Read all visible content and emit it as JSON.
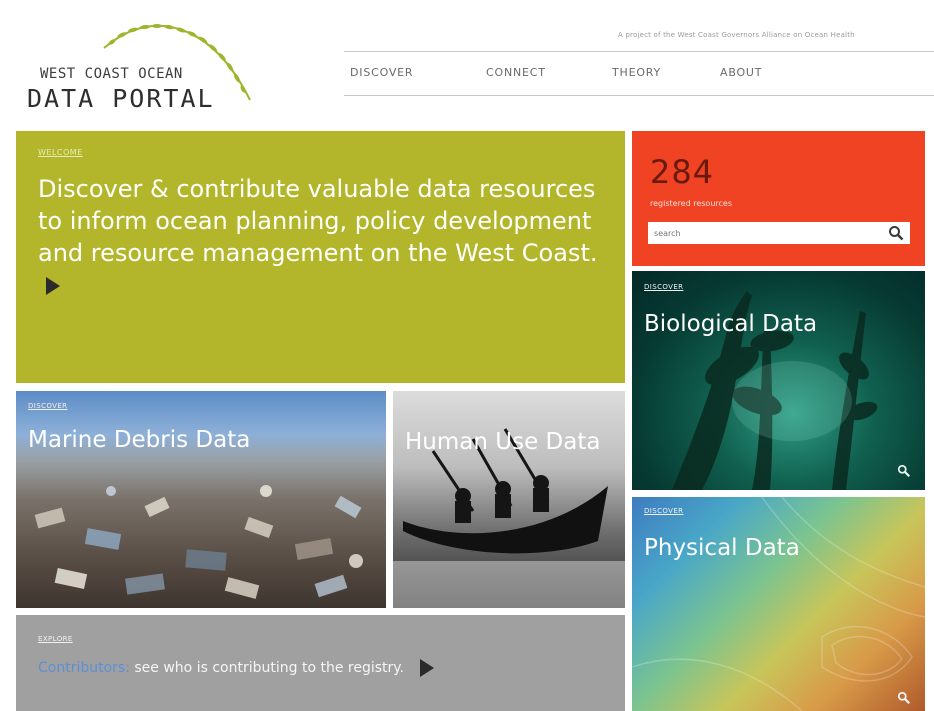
{
  "header": {
    "logo_line1": "WEST COAST OCEAN",
    "logo_line2": "DATA PORTAL",
    "tagline": "A project of the West Coast Governors Alliance on Ocean Health",
    "nav": [
      {
        "label": "DISCOVER"
      },
      {
        "label": "CONNECT"
      },
      {
        "label": "THEORY"
      },
      {
        "label": "ABOUT"
      }
    ]
  },
  "hero": {
    "kicker": "WELCOME",
    "text": "Discover & contribute valuable data resources to inform ocean planning, policy development and resource management on the West Coast."
  },
  "stats": {
    "count": "284",
    "label": "registered resources",
    "search_placeholder": "search"
  },
  "tiles": {
    "biological": {
      "kicker": "DISCOVER",
      "title": "Biological Data"
    },
    "physical": {
      "kicker": "DISCOVER",
      "title": "Physical Data"
    },
    "debris": {
      "kicker": "DISCOVER",
      "title": "Marine Debris Data"
    },
    "human": {
      "kicker": "DISCOVER",
      "title": "Human Use Data"
    }
  },
  "contributors": {
    "kicker": "EXPLORE",
    "link": "Contributors:",
    "text": " see who is contributing to the registry."
  },
  "colors": {
    "hero": "#b3b62a",
    "stat": "#ef4323",
    "contrib": "#a0a0a0",
    "link": "#5c8fd6"
  },
  "icons": {
    "search": "search-icon",
    "play": "play-arrow-icon",
    "wave": "kelp-wave-logo-icon"
  }
}
